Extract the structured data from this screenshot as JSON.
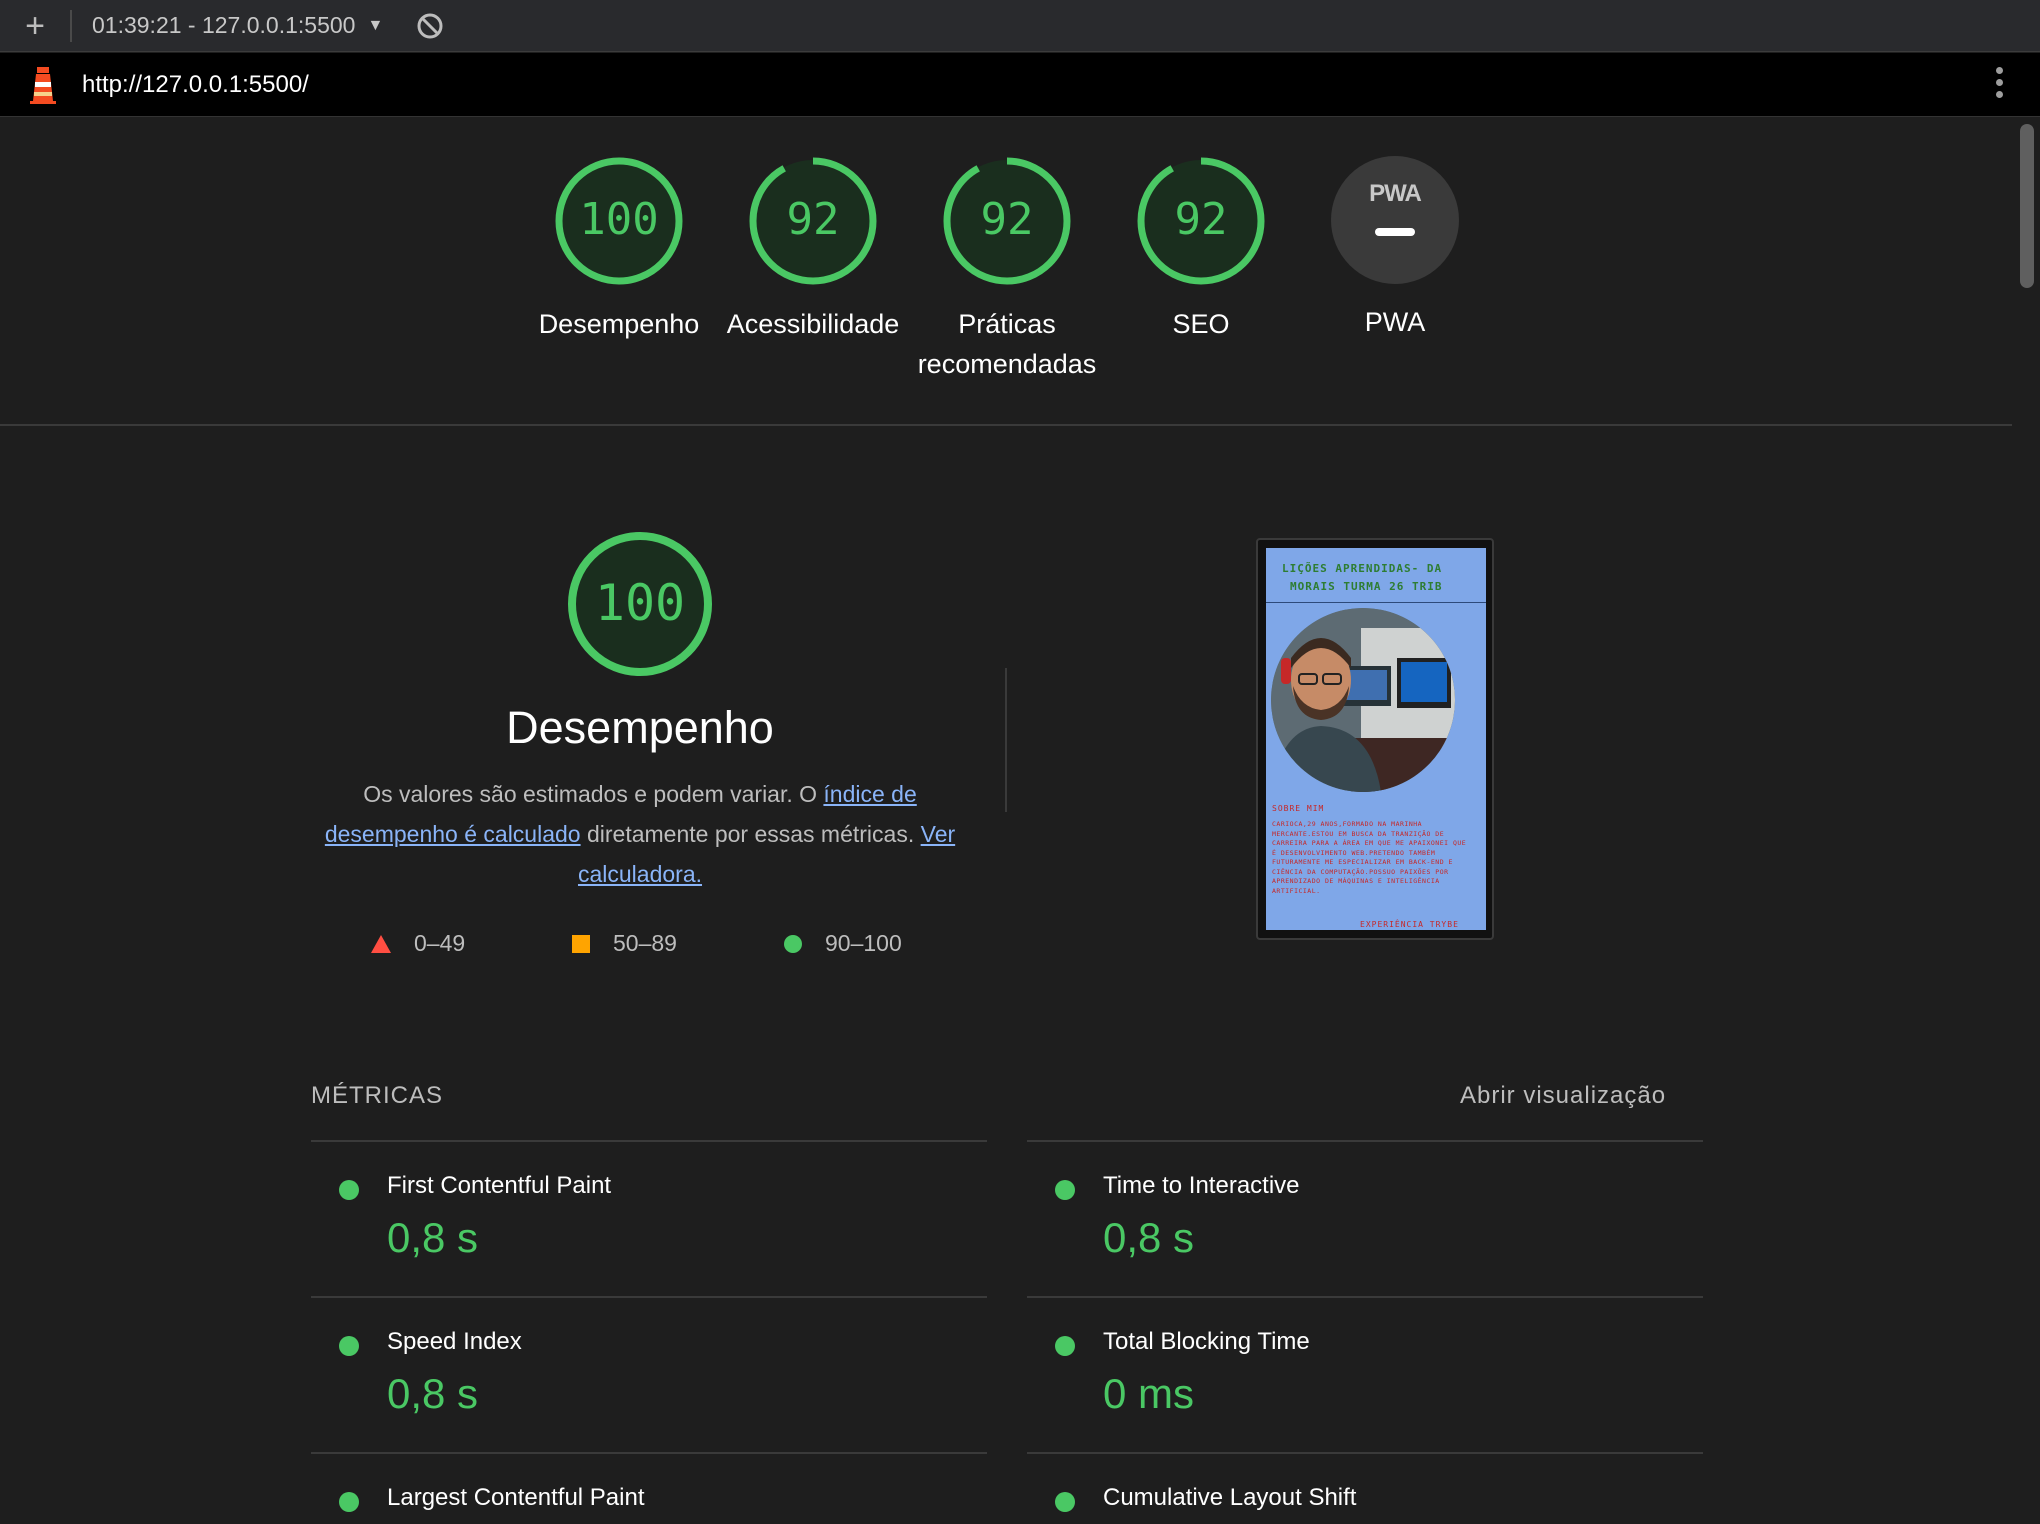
{
  "toolbar": {
    "new_label": "+",
    "report_label": "01:39:21 - 127.0.0.1:5500"
  },
  "urlbar": {
    "url": "http://127.0.0.1:5500/"
  },
  "gauges": [
    {
      "score": "100",
      "score_value": 100,
      "label": "Desempenho"
    },
    {
      "score": "92",
      "score_value": 92,
      "label": "Acessibilidade"
    },
    {
      "score": "92",
      "score_value": 92,
      "label_line1": "Práticas",
      "label_line2": "recomendadas"
    },
    {
      "score": "92",
      "score_value": 92,
      "label": "SEO"
    },
    {
      "badge": "PWA",
      "label": "PWA"
    }
  ],
  "performance": {
    "score": "100",
    "title": "Desempenho",
    "desc_part1": "Os valores são estimados e podem variar. O ",
    "desc_link1": "índice de desempenho é calculado",
    "desc_part2": " diretamente por essas métricas. ",
    "desc_link2": "Ver calculadora.",
    "legend": [
      {
        "range": "0–49",
        "color": "#ff4e42"
      },
      {
        "range": "50–89",
        "color": "#ffa400"
      },
      {
        "range": "90–100",
        "color": "#4ac864"
      }
    ]
  },
  "thumbnail": {
    "title_line1": "LIÇÕES APRENDIDAS- DA",
    "title_line2": "MORAIS TURMA 26 TRIB",
    "section": "SOBRE MIM",
    "text": "CARIOCA,29 ANOS,FORMADO NA MARINHA MERCANTE.ESTOU EM BUSCA DA TRANZIÇÃO DE CARREIRA PARA A ÁREA EM QUE ME APAIXONEI QUE É DESENVOLVIMENTO WEB.PRETENDO TAMBÉM FUTURAMENTE ME ESPECIALIZAR EM BACK-END E CIÊNCIA DA COMPUTAÇÃO.POSSUO PAIXÕES POR APRENDIZADO DE MÁQUINAS E INTELIGÊNCIA ARTIFICIAL.",
    "footer": "EXPERIÊNCIA TRYBE"
  },
  "metrics": {
    "title": "MÉTRICAS",
    "toggle": "Abrir visualização",
    "items": [
      {
        "name": "First Contentful Paint",
        "value": "0,8 s"
      },
      {
        "name": "Time to Interactive",
        "value": "0,8 s"
      },
      {
        "name": "Speed Index",
        "value": "0,8 s"
      },
      {
        "name": "Total Blocking Time",
        "value": "0 ms"
      },
      {
        "name": "Largest Contentful Paint",
        "value": ""
      },
      {
        "name": "Cumulative Layout Shift",
        "value": ""
      }
    ]
  },
  "colors": {
    "pass": "#4ac864",
    "pass_bg": "#1a2e1e",
    "background": "#1e1e1e",
    "link": "#8ab4f8"
  }
}
